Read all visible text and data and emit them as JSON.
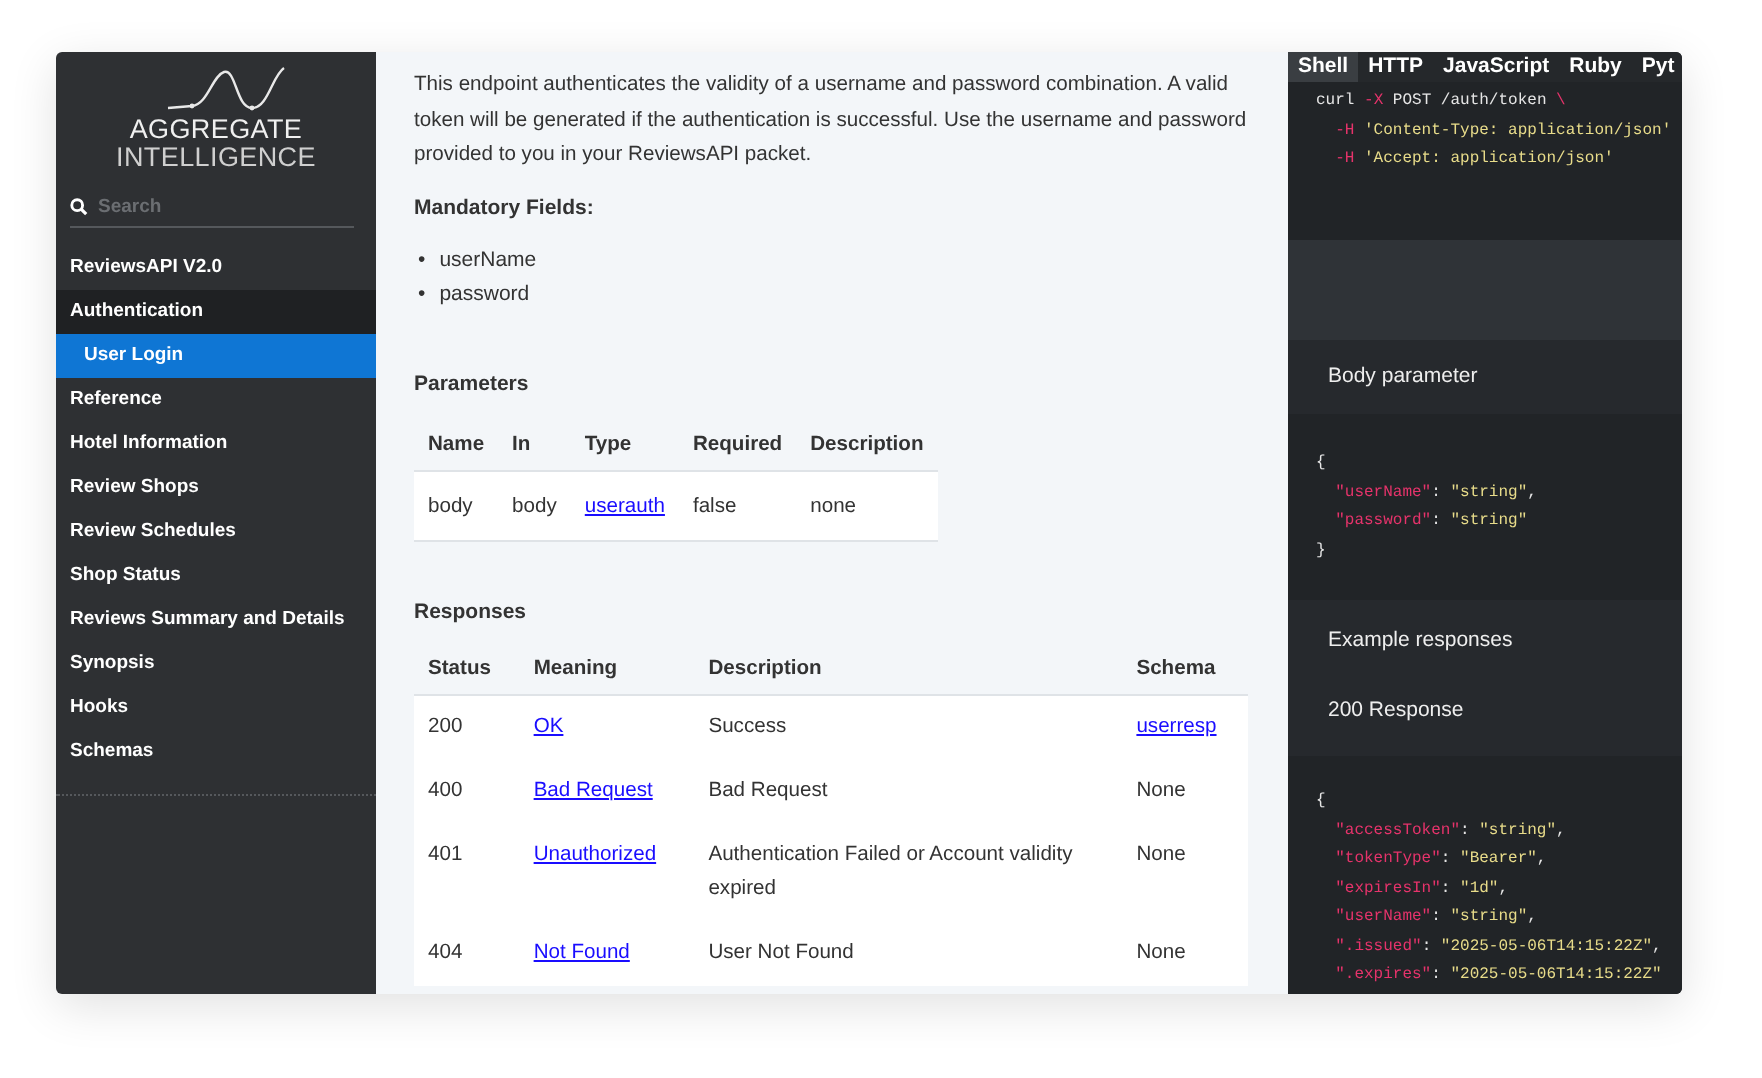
{
  "sidebar": {
    "logo": {
      "line_1": "AGGREGATE",
      "line_2": "INTELLIGENCE"
    },
    "search": {
      "placeholder": "Search"
    },
    "items": [
      {
        "label": "ReviewsAPI V2.0",
        "selected": false,
        "expanded": false
      },
      {
        "label": "Authentication",
        "selected": false,
        "expanded": true,
        "children": [
          {
            "label": "User Login",
            "selected": true
          }
        ]
      },
      {
        "label": "Reference",
        "selected": false,
        "expanded": false
      },
      {
        "label": "Hotel Information",
        "selected": false,
        "expanded": false
      },
      {
        "label": "Review Shops",
        "selected": false,
        "expanded": false
      },
      {
        "label": "Review Schedules",
        "selected": false,
        "expanded": false
      },
      {
        "label": "Shop Status",
        "selected": false,
        "expanded": false
      },
      {
        "label": "Reviews Summary and Details",
        "selected": false,
        "expanded": false
      },
      {
        "label": "Synopsis",
        "selected": false,
        "expanded": false
      },
      {
        "label": "Hooks",
        "selected": false,
        "expanded": false
      },
      {
        "label": "Schemas",
        "selected": false,
        "expanded": false
      }
    ]
  },
  "content": {
    "intro": "This endpoint authenticates the validity of a username and password combination. A valid token will be generated if the authentication is successful. Use the username and password provided to you in your ReviewsAPI packet.",
    "mandatory_title": "Mandatory Fields:",
    "mandatory_fields": [
      {
        "bullet": "•",
        "text": "userName"
      },
      {
        "bullet": "•",
        "text": "password"
      }
    ],
    "parameters": {
      "title": "Parameters",
      "columns": [
        "Name",
        "In",
        "Type",
        "Required",
        "Description"
      ],
      "rows": [
        {
          "name": "body",
          "in": "body",
          "type": "userauth",
          "required": "false",
          "description": "none"
        }
      ]
    },
    "responses": {
      "title": "Responses",
      "columns": [
        "Status",
        "Meaning",
        "Description",
        "Schema"
      ],
      "rows": [
        {
          "status": "200",
          "meaning": "OK",
          "description": "Success",
          "schema": "userresp",
          "schema_link": true
        },
        {
          "status": "400",
          "meaning": "Bad Request",
          "description": "Bad Request",
          "schema": "None",
          "schema_link": false
        },
        {
          "status": "401",
          "meaning": "Unauthorized",
          "description": "Authentication Failed or Account validity expired",
          "schema": "None",
          "schema_link": false
        },
        {
          "status": "404",
          "meaning": "Not Found",
          "description": "User Not Found",
          "schema": "None",
          "schema_link": false
        }
      ]
    }
  },
  "code_panel": {
    "tabs": [
      {
        "label": "Shell",
        "selected": true
      },
      {
        "label": "HTTP",
        "selected": false
      },
      {
        "label": "JavaScript",
        "selected": false
      },
      {
        "label": "Ruby",
        "selected": false
      },
      {
        "label": "Pyt",
        "selected": false
      }
    ],
    "shell_code": [
      {
        "indented": false,
        "tokens": [
          {
            "text": "curl ",
            "kind": "plain"
          },
          {
            "text": "-X",
            "kind": "flag"
          },
          {
            "text": " POST /auth/token ",
            "kind": "plain"
          },
          {
            "text": "\\",
            "kind": "flag"
          }
        ]
      },
      {
        "indented": true,
        "tokens": [
          {
            "text": "-H",
            "kind": "flag"
          },
          {
            "text": " 'Content-Type: application/json'",
            "kind": "str"
          }
        ]
      },
      {
        "indented": true,
        "tokens": [
          {
            "text": "-H",
            "kind": "flag"
          },
          {
            "text": " 'Accept: application/json'",
            "kind": "str"
          }
        ]
      }
    ],
    "body_title": "Body parameter",
    "body_code": [
      {
        "indented": false,
        "tokens": [
          {
            "text": "{",
            "kind": "plain"
          }
        ]
      },
      {
        "indented": true,
        "tokens": [
          {
            "text": "\"userName\"",
            "kind": "key"
          },
          {
            "text": ": ",
            "kind": "plain"
          },
          {
            "text": "\"string\"",
            "kind": "str"
          },
          {
            "text": ",",
            "kind": "plain"
          }
        ]
      },
      {
        "indented": true,
        "tokens": [
          {
            "text": "\"password\"",
            "kind": "key"
          },
          {
            "text": ": ",
            "kind": "plain"
          },
          {
            "text": "\"string\"",
            "kind": "str"
          }
        ]
      },
      {
        "indented": false,
        "tokens": [
          {
            "text": "}",
            "kind": "plain"
          }
        ]
      }
    ],
    "examples_title": "Example responses",
    "response_title": "200 Response",
    "response_code": [
      {
        "indented": false,
        "tokens": [
          {
            "text": "{",
            "kind": "plain"
          }
        ]
      },
      {
        "indented": true,
        "tokens": [
          {
            "text": "\"accessToken\"",
            "kind": "key"
          },
          {
            "text": ": ",
            "kind": "plain"
          },
          {
            "text": "\"string\"",
            "kind": "str"
          },
          {
            "text": ",",
            "kind": "plain"
          }
        ]
      },
      {
        "indented": true,
        "tokens": [
          {
            "text": "\"tokenType\"",
            "kind": "key"
          },
          {
            "text": ": ",
            "kind": "plain"
          },
          {
            "text": "\"Bearer\"",
            "kind": "str"
          },
          {
            "text": ",",
            "kind": "plain"
          }
        ]
      },
      {
        "indented": true,
        "tokens": [
          {
            "text": "\"expiresIn\"",
            "kind": "key"
          },
          {
            "text": ": ",
            "kind": "plain"
          },
          {
            "text": "\"1d\"",
            "kind": "str"
          },
          {
            "text": ",",
            "kind": "plain"
          }
        ]
      },
      {
        "indented": true,
        "tokens": [
          {
            "text": "\"userName\"",
            "kind": "key"
          },
          {
            "text": ": ",
            "kind": "plain"
          },
          {
            "text": "\"string\"",
            "kind": "str"
          },
          {
            "text": ",",
            "kind": "plain"
          }
        ]
      },
      {
        "indented": true,
        "tokens": [
          {
            "text": "\".issued\"",
            "kind": "key"
          },
          {
            "text": ": ",
            "kind": "plain"
          },
          {
            "text": "\"2025-05-06T14:15:22Z\"",
            "kind": "str"
          },
          {
            "text": ",",
            "kind": "plain"
          }
        ]
      },
      {
        "indented": true,
        "tokens": [
          {
            "text": "\".expires\"",
            "kind": "key"
          },
          {
            "text": ": ",
            "kind": "plain"
          },
          {
            "text": "\"2025-05-06T14:15:22Z\"",
            "kind": "str"
          }
        ]
      }
    ]
  }
}
